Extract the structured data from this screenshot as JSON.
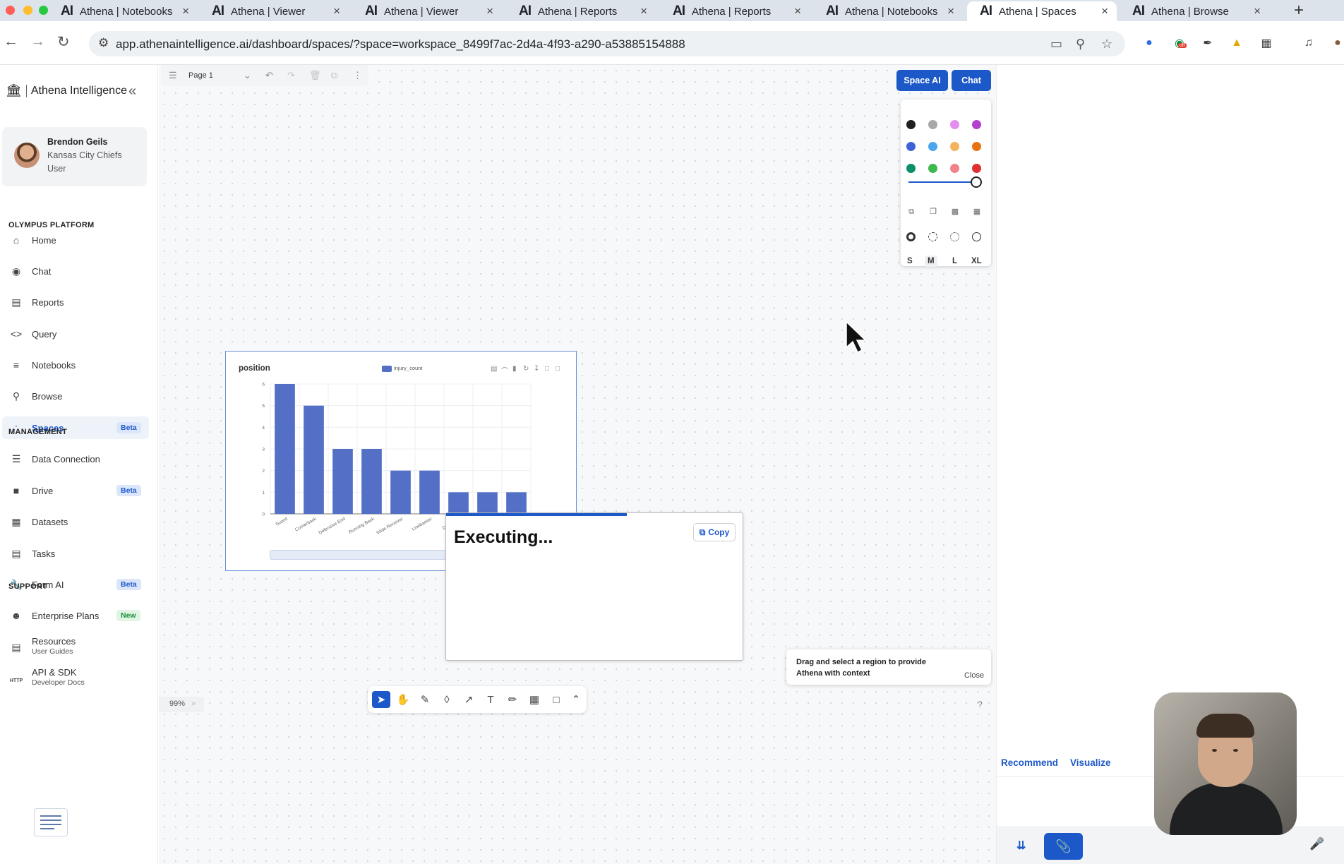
{
  "browser": {
    "tabs": [
      {
        "title": "Athena | Notebooks",
        "icon": "AI"
      },
      {
        "title": "Athena | Viewer",
        "icon": "AI"
      },
      {
        "title": "Athena | Viewer",
        "icon": "AI"
      },
      {
        "title": "Athena | Reports",
        "icon": "AI"
      },
      {
        "title": "Athena | Reports",
        "icon": "AI"
      },
      {
        "title": "Athena | Notebooks",
        "icon": "AI"
      },
      {
        "title": "Athena | Spaces",
        "icon": "AI",
        "active": true
      },
      {
        "title": "Athena | Browse",
        "icon": "AI"
      }
    ],
    "url": "app.athenaintelligence.ai/dashboard/spaces/?space=workspace_8499f7ac-2d4a-4f93-a290-a53885154888",
    "extension_badge": "off"
  },
  "sidebar": {
    "brand": "Athena Intelligence",
    "user": {
      "name": "Brendon Geils",
      "org": "Kansas City Chiefs",
      "role": "User"
    },
    "sections": [
      {
        "title": "OLYMPUS PLATFORM",
        "items": [
          {
            "label": "Home",
            "icon": "home-icon"
          },
          {
            "label": "Chat",
            "icon": "chat-icon"
          },
          {
            "label": "Reports",
            "icon": "clipboard-icon"
          },
          {
            "label": "Query",
            "icon": "code-icon"
          },
          {
            "label": "Notebooks",
            "icon": "lines-icon"
          },
          {
            "label": "Browse",
            "icon": "globe-search-icon"
          },
          {
            "label": "Spaces",
            "icon": "spaces-icon",
            "badge": "Beta",
            "active": true
          }
        ]
      },
      {
        "title": "MANAGEMENT",
        "items": [
          {
            "label": "Data Connection",
            "icon": "list-icon"
          },
          {
            "label": "Drive",
            "icon": "drive-icon",
            "badge": "Beta"
          },
          {
            "label": "Datasets",
            "icon": "grid-icon"
          },
          {
            "label": "Tasks",
            "icon": "document-icon"
          },
          {
            "label": "Form AI",
            "icon": "wrench-icon",
            "badge": "Beta"
          }
        ]
      },
      {
        "title": "SUPPORT",
        "items": [
          {
            "label": "Enterprise Plans",
            "icon": "people-icon",
            "badge": "New"
          },
          {
            "label": "Resources",
            "sub": "User Guides",
            "icon": "book-icon"
          },
          {
            "label": "API & SDK",
            "sub": "Developer Docs",
            "icon": "http-icon"
          }
        ]
      }
    ]
  },
  "canvas": {
    "page_name": "Page 1",
    "space_ai_label": "Space AI",
    "chat_label": "Chat",
    "zoom": "99%",
    "style_panel": {
      "colors": [
        "#1f1f1f",
        "#a8a8a8",
        "#e48ef0",
        "#b43fd1",
        "#3b63d8",
        "#4aa6ee",
        "#f4b35e",
        "#e8720f",
        "#0b8f6a",
        "#3eb94e",
        "#f0838a",
        "#e0302f"
      ],
      "opacity": 1.0,
      "sizes": [
        "S",
        "M",
        "L",
        "XL"
      ],
      "selected_size": "M"
    },
    "executing_text": "Executing...",
    "copy_label": "Copy",
    "exec_progress": 0.61,
    "toast_text": "Drag and select a region to provide Athena with context",
    "toast_close": "Close",
    "help": "?"
  },
  "chart_data": {
    "type": "bar",
    "title": "position",
    "legend": [
      "injury_count"
    ],
    "categories": [
      "Guard",
      "Cornerback",
      "Defensive End",
      "Running Back",
      "Wide Receiver",
      "Linebacker",
      "Defensive",
      "",
      ""
    ],
    "values": [
      6,
      5,
      3,
      3,
      2,
      2,
      1,
      1,
      1
    ],
    "ylim": [
      0,
      6
    ],
    "yticks": [
      "0",
      "1",
      "2",
      "3",
      "4",
      "5",
      "6"
    ],
    "color": "#5470c6",
    "grid": true
  },
  "right_panel": {
    "tabs": [
      "Recommend",
      "Visualize"
    ]
  }
}
